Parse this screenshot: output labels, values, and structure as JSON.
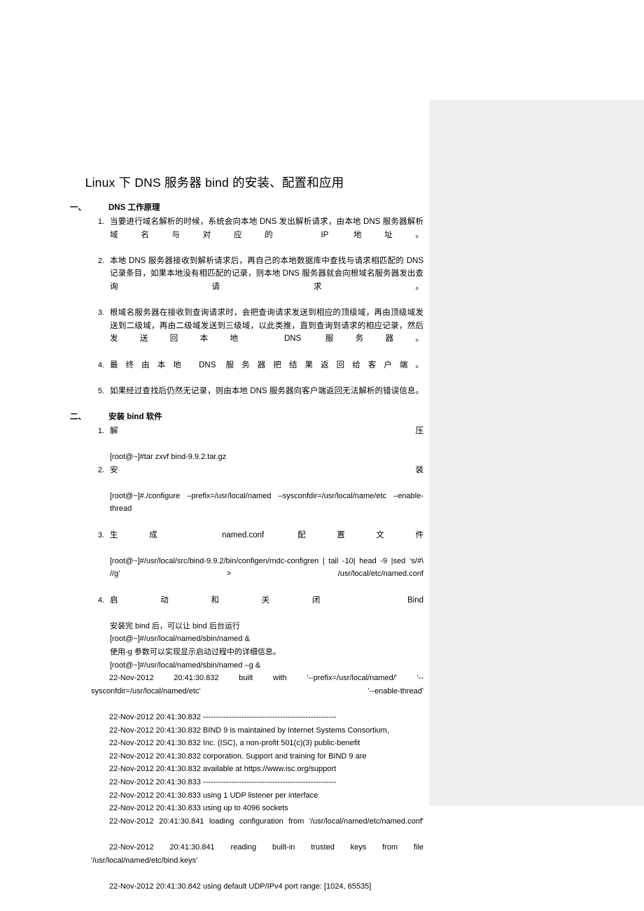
{
  "document": {
    "title": "Linux 下 DNS 服务器 bind 的安装、配置和应用"
  },
  "sections": [
    {
      "marker": "一、",
      "heading": "DNS 工作原理",
      "steps": [
        {
          "num": "1.",
          "text": "当要进行域名解析的时候，系统会向本地 DNS 发出解析请求，由本地 DNS 服务器解析域名与对应的 IP 地址。"
        },
        {
          "num": "2.",
          "text": "本地 DNS 服务器接收到解析请求后，再自己的本地数据库中查找与请求相匹配的 DNS 记录条目，如果本地没有相匹配的记录，则本地 DNS 服务器就会向根域名服务器发出查询请求。"
        },
        {
          "num": "3.",
          "text": "根域名服务器在接收到查询请求时，会把查询请求发送到相应的顶级域，再由顶级域发送到二级域，再由二级域发送到三级域，以此类推，直到查询到请求的相应记录，然后发送回本地 DNS 服务器。"
        },
        {
          "num": "4.",
          "text": "最终由本地 DNS 服务器把结果返回给客户端。"
        },
        {
          "num": "5.",
          "text": "如果经过查找后仍然无记录，则由本地 DNS 服务器向客户端返回无法解析的错误信息。"
        }
      ]
    },
    {
      "marker": "二、",
      "heading": "安装 bind 软件",
      "steps": [
        {
          "num": "1.",
          "text": "解压",
          "subs": [
            "[root@~]#tar zxvf bind-9.9.2.tar.gz"
          ]
        },
        {
          "num": "2.",
          "text": "安装",
          "subs": [
            "[root@~]#./configure  –prefix=/usr/local/named  –sysconfdir=/usr/local/name/etc  –enable-thread"
          ]
        },
        {
          "num": "3.",
          "text": "生成 named.conf 配置文件",
          "subs": [
            "[root@~]#/usr/local/src/bind-9.9.2/bin/configen/rndc-configren | tail -10| head -9 |sed ‘s/#\\ //g’ > /usr/local/etc/named.conf"
          ]
        },
        {
          "num": "4.",
          "text": "启动和关闭 Bind",
          "subs": [
            "安装完 bind 后，可以让 bind 后台运行",
            "[root@~]#/usr/local/named/sbin/named &",
            "使用-g 参数可以实现显示启动过程中的详细信息。",
            "[root@~]#/usr/local/named/sbin/named –g &"
          ],
          "log": [
            {
              "text": "22-Nov-2012 20:41:30.832 built with '--prefix=/usr/local/named/' '--sysconfdir=/usr/local/named/etc' '--enable-thread'",
              "justify": true
            },
            {
              "text": "22-Nov-2012 20:41:30.832 ----------------------------------------------------",
              "justify": false
            },
            {
              "text": "22-Nov-2012 20:41:30.832 BIND 9 is maintained by Internet Systems Consortium,",
              "justify": false
            },
            {
              "text": "22-Nov-2012 20:41:30.832 Inc. (ISC), a non-profit 501(c)(3) public-benefit",
              "justify": false
            },
            {
              "text": "22-Nov-2012 20:41:30.832 corporation.    Support and training for BIND 9 are",
              "justify": false
            },
            {
              "text": "22-Nov-2012 20:41:30.832 available at https://www.isc.org/support",
              "justify": false
            },
            {
              "text": "22-Nov-2012 20:41:30.833 ----------------------------------------------------",
              "justify": false
            },
            {
              "text": "22-Nov-2012 20:41:30.833 using 1 UDP listener per interface",
              "justify": false
            },
            {
              "text": "22-Nov-2012 20:41:30.833 using up to 4096 sockets",
              "justify": false
            },
            {
              "text": "22-Nov-2012 20:41:30.841 loading configuration from '/usr/local/named/etc/named.conf'",
              "justify": true
            },
            {
              "text": "22-Nov-2012 20:41:30.841 reading built-in trusted keys from file '/usr/local/named/etc/bind.keys'",
              "justify": true
            },
            {
              "text": "22-Nov-2012 20:41:30.842 using default UDP/IPv4 port range: [1024, 65535]",
              "justify": false
            }
          ]
        }
      ]
    }
  ],
  "colors": {
    "page_background": "#ffffff",
    "side_panel": "#f0f0f0",
    "text": "#000000"
  }
}
